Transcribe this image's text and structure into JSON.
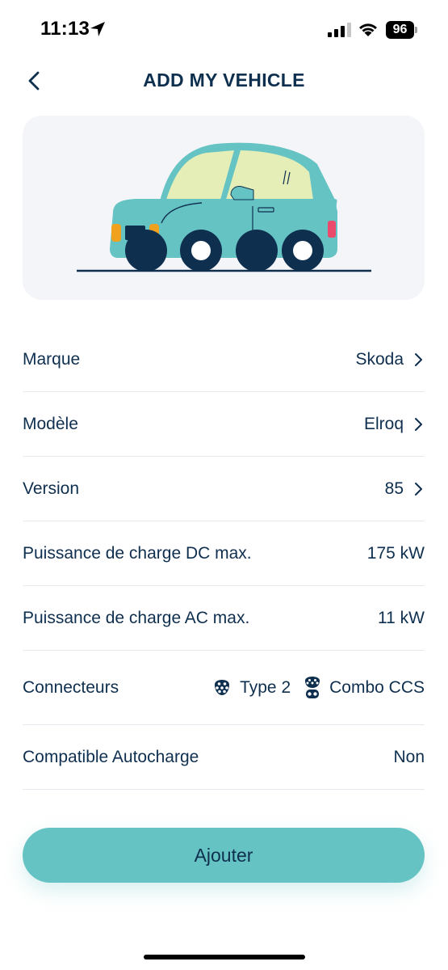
{
  "status_bar": {
    "time": "11:13",
    "battery": "96"
  },
  "header": {
    "title": "ADD MY VEHICLE"
  },
  "colors": {
    "accent": "#66c3c4",
    "text": "#0f2f4f",
    "card_bg": "#f4f5f9"
  },
  "vehicle_rows": [
    {
      "label": "Marque",
      "value": "Skoda",
      "chevron": true
    },
    {
      "label": "Modèle",
      "value": "Elroq",
      "chevron": true
    },
    {
      "label": "Version",
      "value": "85",
      "chevron": true
    },
    {
      "label": "Puissance de charge DC max.",
      "value": "175 kW",
      "chevron": false
    },
    {
      "label": "Puissance de charge AC max.",
      "value": "11 kW",
      "chevron": false
    }
  ],
  "connectors": {
    "label": "Connecteurs",
    "items": [
      {
        "icon": "type2-plug-icon",
        "name": "Type 2"
      },
      {
        "icon": "combo-ccs-plug-icon",
        "name": "Combo CCS"
      }
    ]
  },
  "autocharge": {
    "label": "Compatible Autocharge",
    "value": "Non"
  },
  "actions": {
    "add_label": "Ajouter"
  }
}
